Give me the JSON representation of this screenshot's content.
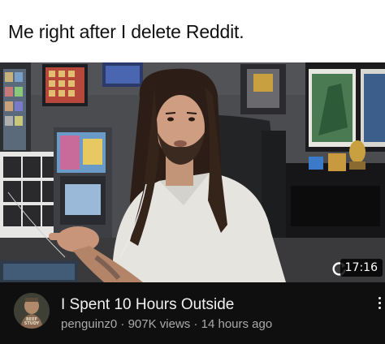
{
  "caption": "Me right after I delete Reddit.",
  "video": {
    "duration": "17:16",
    "title": "I Spent 10 Hours Outside",
    "channel": "penguinz0",
    "views": "907K views",
    "age": "14 hours ago",
    "separator": "·"
  },
  "avatar": {
    "text_line1": "BEEF",
    "text_line2": "STUDY"
  },
  "icons": {
    "replay": "replay-icon",
    "menu": "more-vert-icon"
  },
  "colors": {
    "meta_bar_bg": "#0f0f0f",
    "title_text": "#f1f1f1",
    "meta_text": "#aaaaaa"
  }
}
